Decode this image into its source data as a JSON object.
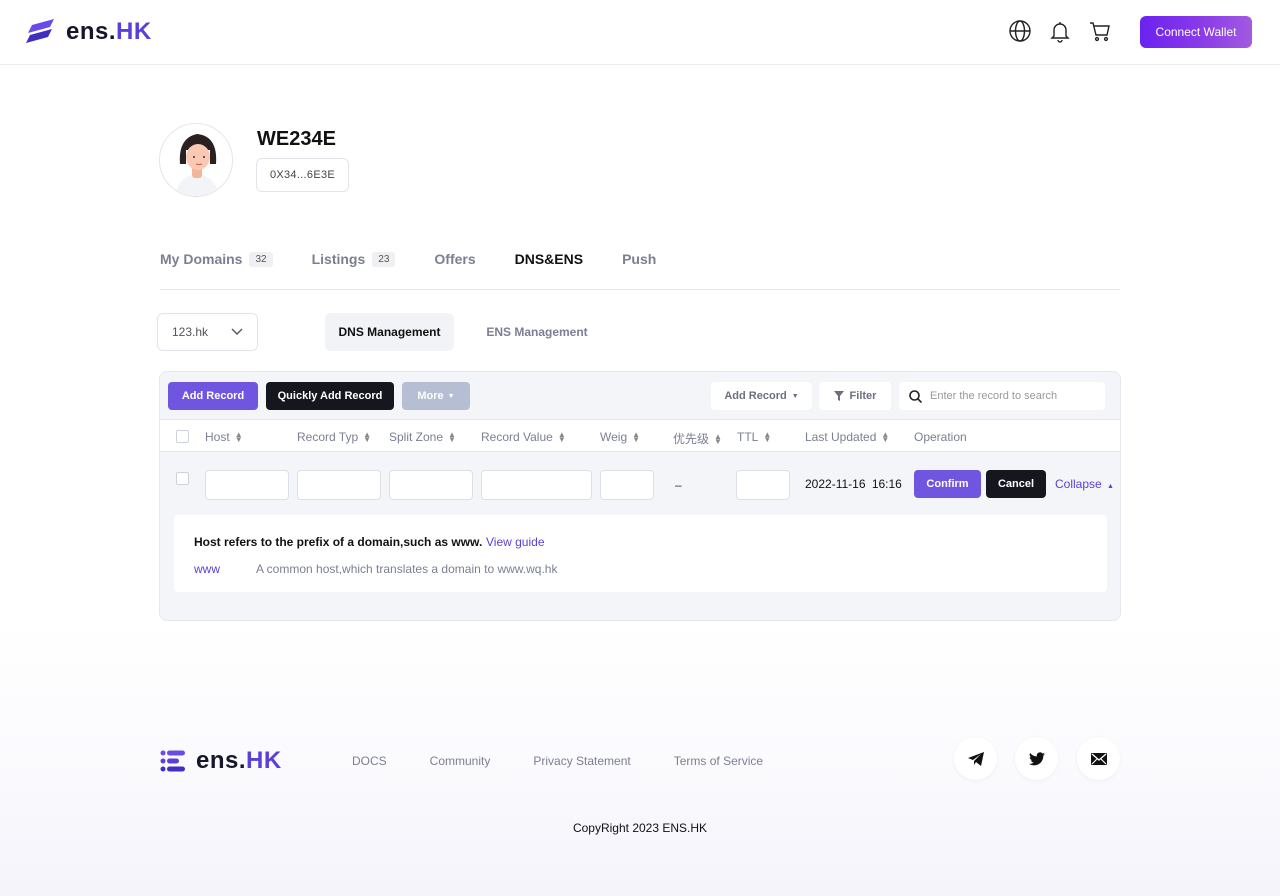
{
  "header": {
    "logo_prefix": "ens.",
    "logo_suffix": "HK",
    "connect_label": "Connect Wallet"
  },
  "profile": {
    "name": "WE234E",
    "address": "0X34...6E3E"
  },
  "tabs": [
    {
      "label": "My Domains",
      "count": "32"
    },
    {
      "label": "Listings",
      "count": "23"
    },
    {
      "label": "Offers"
    },
    {
      "label": "DNS&ENS",
      "active": true
    },
    {
      "label": "Push"
    }
  ],
  "domain_select": {
    "value": "123.hk"
  },
  "subtabs": {
    "dns": "DNS  Management",
    "ens": "ENS  Management"
  },
  "toolbar": {
    "add_record": "Add Record",
    "quick_add": "Quickly Add Record",
    "more": "More",
    "add_record_dropdown": "Add Record",
    "filter": "Filter",
    "search_placeholder": "Enter the record to search"
  },
  "table": {
    "columns": [
      "Host",
      "Record Typ",
      "Split Zone",
      "Record Value",
      "Weig",
      "优先级",
      "TTL",
      "Last Updated",
      "Operation"
    ],
    "row": {
      "priority": "–",
      "last_updated": "2022-11-16  16:16",
      "confirm": "Confirm",
      "cancel": "Cancel",
      "collapse": "Collapse"
    }
  },
  "guide": {
    "title": "Host refers to the prefix of a domain,such as www.",
    "link": "View guide",
    "key": "www",
    "desc": "A common host,which translates a domain to www.wq.hk"
  },
  "footer": {
    "links": [
      "DOCS",
      "Community",
      "Privacy Statement",
      "Terms of Service"
    ],
    "copyright": "CopyRight 2023 ENS.HK"
  },
  "colors": {
    "accent": "#6f55e0",
    "dark": "#16161f",
    "brand": "#5b3fd9"
  }
}
